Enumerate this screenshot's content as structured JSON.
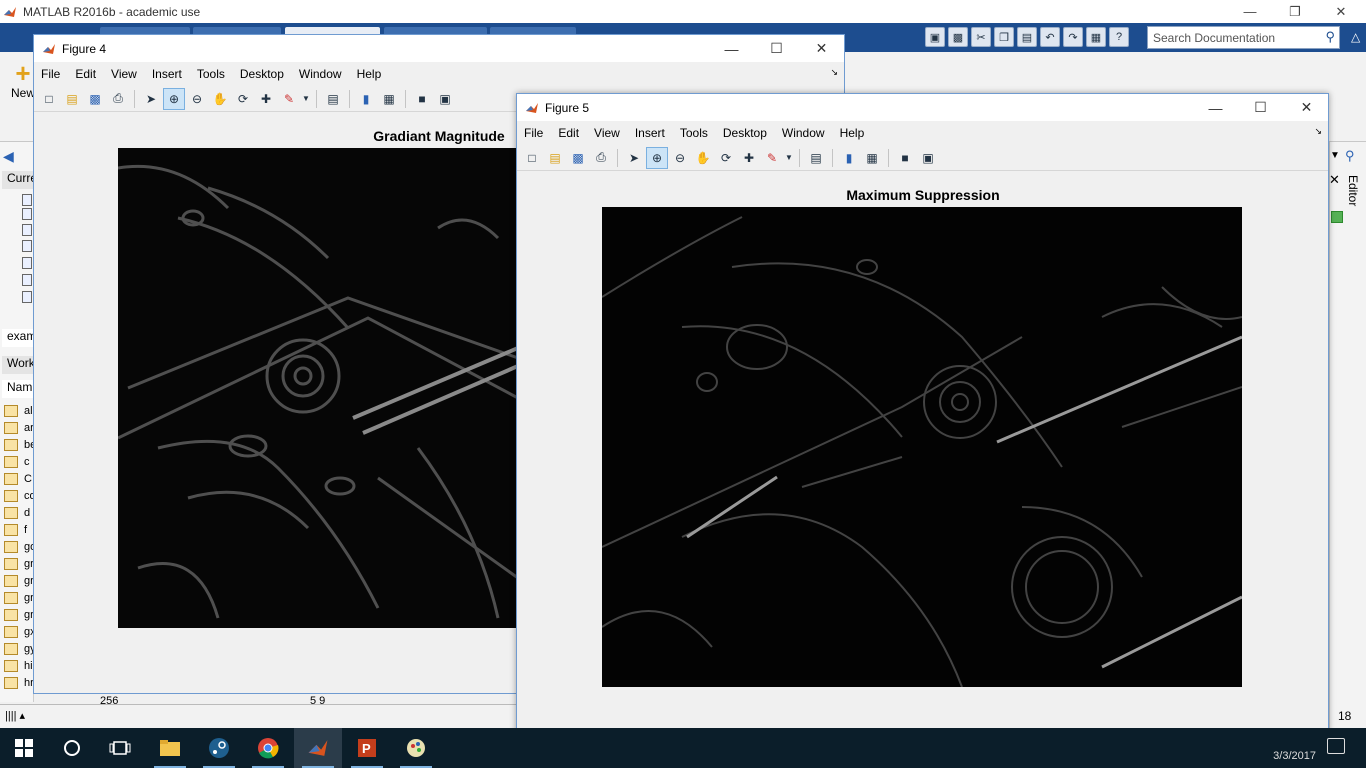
{
  "matlab": {
    "title": "MATLAB R2016b - academic use",
    "search_placeholder": "Search Documentation",
    "new_label": "New",
    "current_folder_header": "Curre",
    "path_text": "exam",
    "workspace_header": "Work",
    "name_column": "Nam",
    "workspace_vars": [
      "al",
      "ar",
      "be",
      "c",
      "C",
      "co",
      "d",
      "f",
      "go",
      "gr",
      "gr",
      "gr",
      "gr",
      "gx",
      "gy",
      "hi",
      "hr"
    ],
    "editor_tab": "Editor",
    "right_value": "18",
    "bottom_value_a": "256",
    "bottom_value_b": "5 9"
  },
  "figure4": {
    "title": "Figure 4",
    "menu": [
      "File",
      "Edit",
      "View",
      "Insert",
      "Tools",
      "Desktop",
      "Window",
      "Help"
    ],
    "plot_title": "Gradiant Magnitude"
  },
  "figure5": {
    "title": "Figure 5",
    "menu": [
      "File",
      "Edit",
      "View",
      "Insert",
      "Tools",
      "Desktop",
      "Window",
      "Help"
    ],
    "plot_title": "Maximum Suppression"
  },
  "toolbar_icons": [
    "new-figure-icon",
    "open-icon",
    "save-icon",
    "print-icon",
    "pointer-icon",
    "zoom-in-icon",
    "zoom-out-icon",
    "pan-icon",
    "rotate-3d-icon",
    "data-cursor-icon",
    "brush-icon",
    "link-icon",
    "colorbar-icon",
    "legend-icon",
    "hide-tools-icon",
    "show-tools-icon"
  ],
  "taskbar": {
    "clock": "3/3/2017",
    "apps": [
      "start-icon",
      "cortana-icon",
      "task-view-icon",
      "file-explorer-icon",
      "steam-icon",
      "chrome-icon",
      "matlab-icon",
      "powerpoint-icon",
      "app-icon"
    ]
  },
  "colors": {
    "matlab_blue": "#1d4d8f",
    "figure_border": "#6f9bd1",
    "taskbar": "#0b1e2a"
  }
}
